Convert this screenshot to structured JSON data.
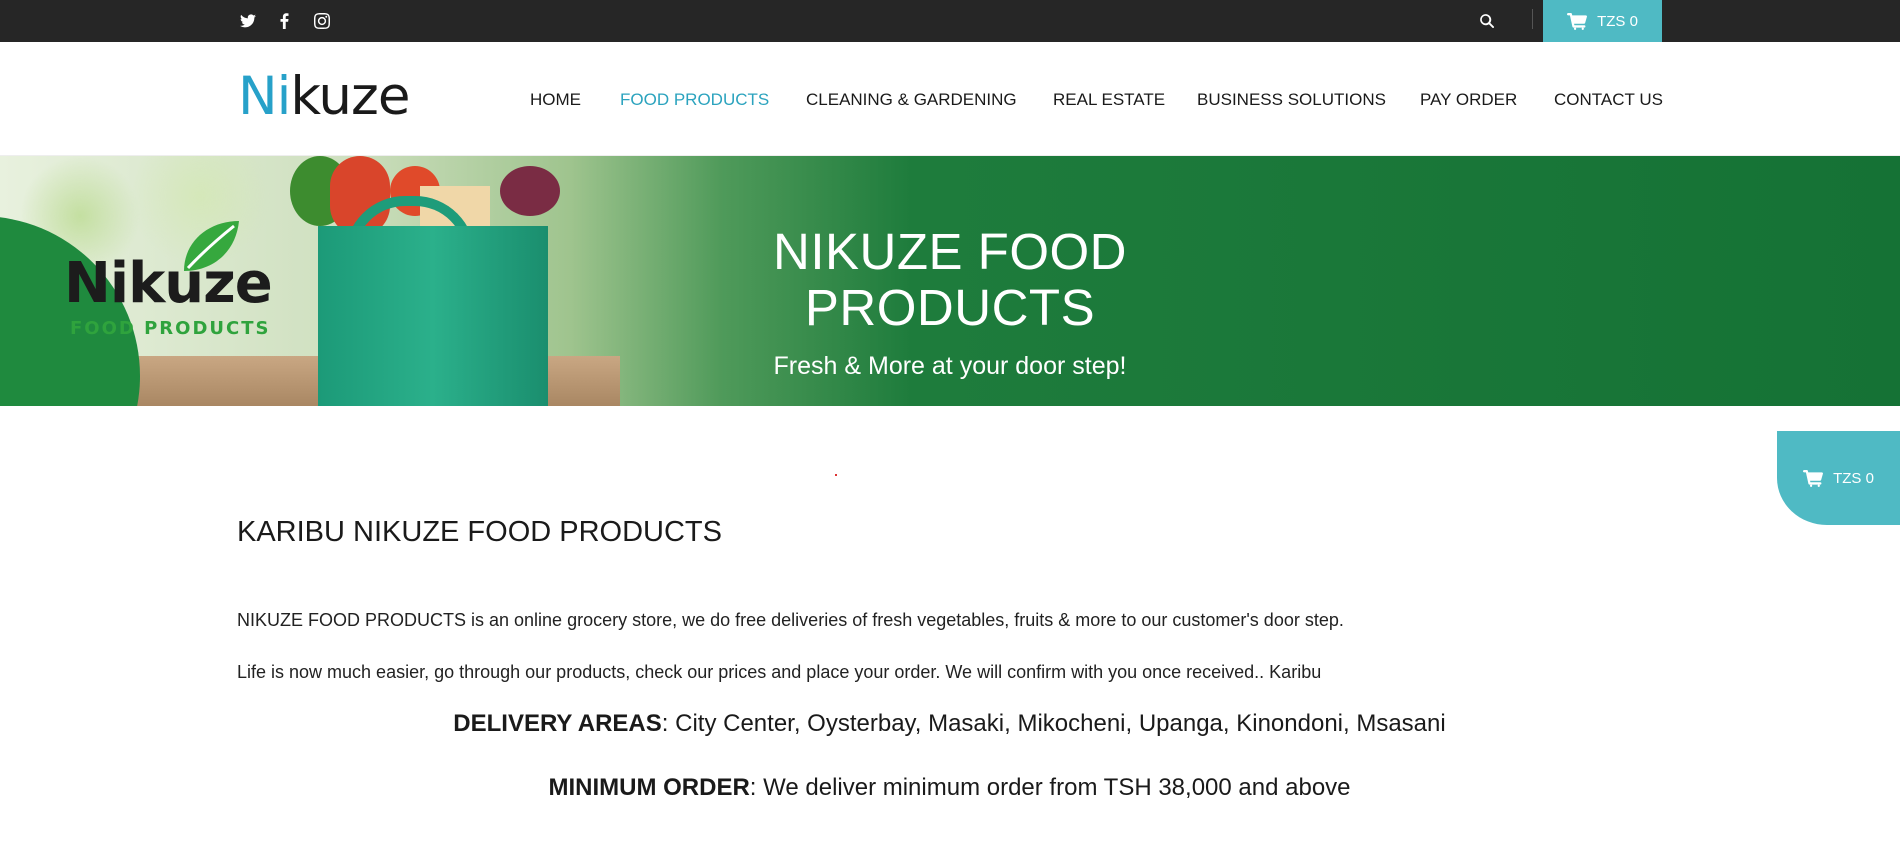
{
  "topbar": {
    "social_icons": [
      "twitter-icon",
      "facebook-icon",
      "instagram-icon"
    ],
    "search_icon": "search-icon",
    "cart_label": "TZS 0"
  },
  "header": {
    "logo": {
      "highlight": "Ni",
      "rest": "kuze"
    },
    "nav": [
      {
        "label": "HOME",
        "active": false
      },
      {
        "label": "FOOD PRODUCTS",
        "active": true
      },
      {
        "label": "CLEANING & GARDENING",
        "active": false
      },
      {
        "label": "REAL ESTATE",
        "active": false
      },
      {
        "label": "BUSINESS SOLUTIONS",
        "active": false
      },
      {
        "label": "PAY ORDER",
        "active": false
      },
      {
        "label": "CONTACT US",
        "active": false
      }
    ]
  },
  "banner": {
    "title": "NIKUZE FOOD PRODUCTS",
    "subtitle": "Fresh & More at your door step!",
    "badge_name": "Nikuze",
    "badge_sub": "FOOD PRODUCTS"
  },
  "floating_cart": {
    "label": "TZS 0"
  },
  "content": {
    "heading": "KARIBU NIKUZE FOOD PRODUCTS",
    "paragraph1": "NIKUZE FOOD PRODUCTS is an online grocery store, we do free deliveries of fresh vegetables, fruits & more to our customer's door step.",
    "paragraph2": "Life is now much easier, go through our products, check our prices and place your order. We will confirm with you once received.. Karibu",
    "delivery": {
      "label": "DELIVERY AREAS",
      "text": ": City Center, Oysterbay, Masaki, Mikocheni, Upanga, Kinondoni, Msasani"
    },
    "minimum": {
      "label": "MINIMUM ORDER",
      "text": ": We deliver minimum order from TSH 38,000 and above"
    }
  },
  "colors": {
    "accent": "#4fbac4",
    "nav_active": "#2ba3be",
    "topbar": "#262626",
    "banner_green": "#157235"
  }
}
